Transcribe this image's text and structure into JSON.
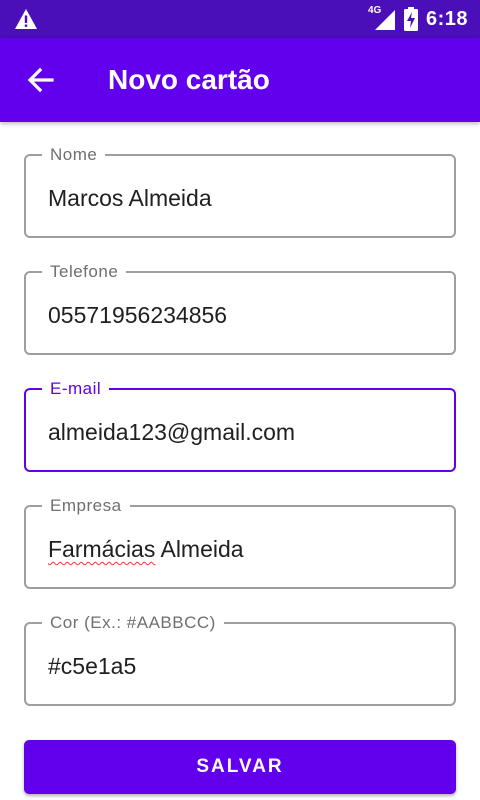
{
  "status_bar": {
    "time": "6:18",
    "network": "4G",
    "icons": [
      "warning-icon",
      "signal-icon",
      "battery-charging-icon"
    ]
  },
  "app_bar": {
    "title": "Novo cartão",
    "back_icon": "arrow-back-icon"
  },
  "form": {
    "fields": [
      {
        "label": "Nome",
        "value": "Marcos Almeida"
      },
      {
        "label": "Telefone",
        "value": "05571956234856"
      },
      {
        "label": "E-mail",
        "value": "almeida123@gmail.com",
        "focused": true
      },
      {
        "label": "Empresa",
        "value_misspelled": "Farmácias",
        "value_rest": " Almeida"
      },
      {
        "label": "Cor (Ex.: #AABBCC)",
        "value": "#c5e1a5"
      }
    ],
    "save_label": "SALVAR"
  },
  "colors": {
    "status_bar": "#4a0fb8",
    "primary": "#6200ee",
    "outline": "#9e9e9e",
    "spellcheck": "#e53935"
  }
}
